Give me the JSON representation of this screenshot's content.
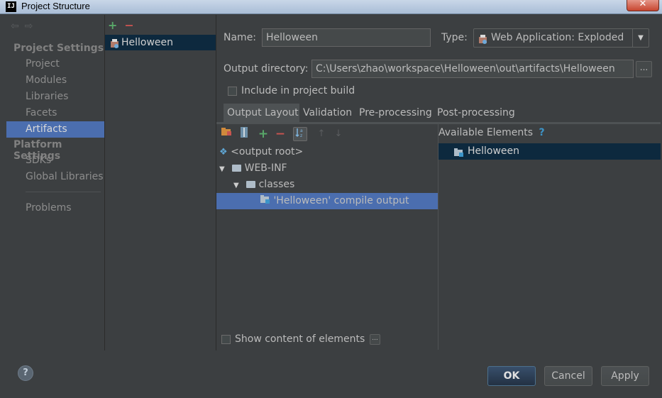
{
  "window": {
    "title": "Project Structure",
    "app_icon": "IJ",
    "close_glyph": "✕"
  },
  "nav": {
    "back_glyph": "⇦",
    "forward_glyph": "⇨",
    "project_settings_header": "Project Settings",
    "project_items": [
      "Project",
      "Modules",
      "Libraries",
      "Facets",
      "Artifacts"
    ],
    "platform_settings_header": "Platform Settings",
    "platform_items": [
      "SDKs",
      "Global Libraries"
    ],
    "problems": "Problems",
    "selected": "Artifacts"
  },
  "artifacts": {
    "add_glyph": "+",
    "remove_glyph": "−",
    "items": [
      "Helloween"
    ]
  },
  "form": {
    "name_label": "Name:",
    "name_value": "Helloween",
    "type_label": "Type:",
    "type_value": "Web Application: Exploded",
    "output_dir_label": "Output directory:",
    "output_dir_value": "C:\\Users\\zhao\\workspace\\Helloween\\out\\artifacts\\Helloween",
    "browse_glyph": "...",
    "include_build_label": "Include in project build",
    "include_build_checked": false
  },
  "tabs": [
    "Output Layout",
    "Validation",
    "Pre-processing",
    "Post-processing"
  ],
  "active_tab": "Output Layout",
  "output_layout": {
    "toolbar": {
      "add_glyph": "+",
      "remove_glyph": "−",
      "up_glyph": "↑",
      "down_glyph": "↓"
    },
    "tree": [
      {
        "label": "<output root>",
        "level": 0,
        "icon": "output-root-icon",
        "expander": ""
      },
      {
        "label": "WEB-INF",
        "level": 0,
        "icon": "folder-icon",
        "expander": "▼"
      },
      {
        "label": "classes",
        "level": 1,
        "icon": "folder-icon",
        "expander": "▼"
      },
      {
        "label": "'Helloween' compile output",
        "level": 2,
        "icon": "module-output-icon",
        "expander": "",
        "selected": true
      }
    ],
    "show_content_label": "Show content of elements",
    "show_content_checked": false,
    "more_glyph": "..."
  },
  "available": {
    "title": "Available Elements",
    "help_glyph": "?",
    "items": [
      "Helloween"
    ]
  },
  "buttons": {
    "help": "?",
    "ok": "OK",
    "cancel": "Cancel",
    "apply": "Apply"
  },
  "colors": {
    "selection": "#4b6eaf",
    "inactive_selection": "#0d293e",
    "background": "#3c3f41",
    "add_green": "#59a869",
    "remove_red": "#c75450"
  }
}
